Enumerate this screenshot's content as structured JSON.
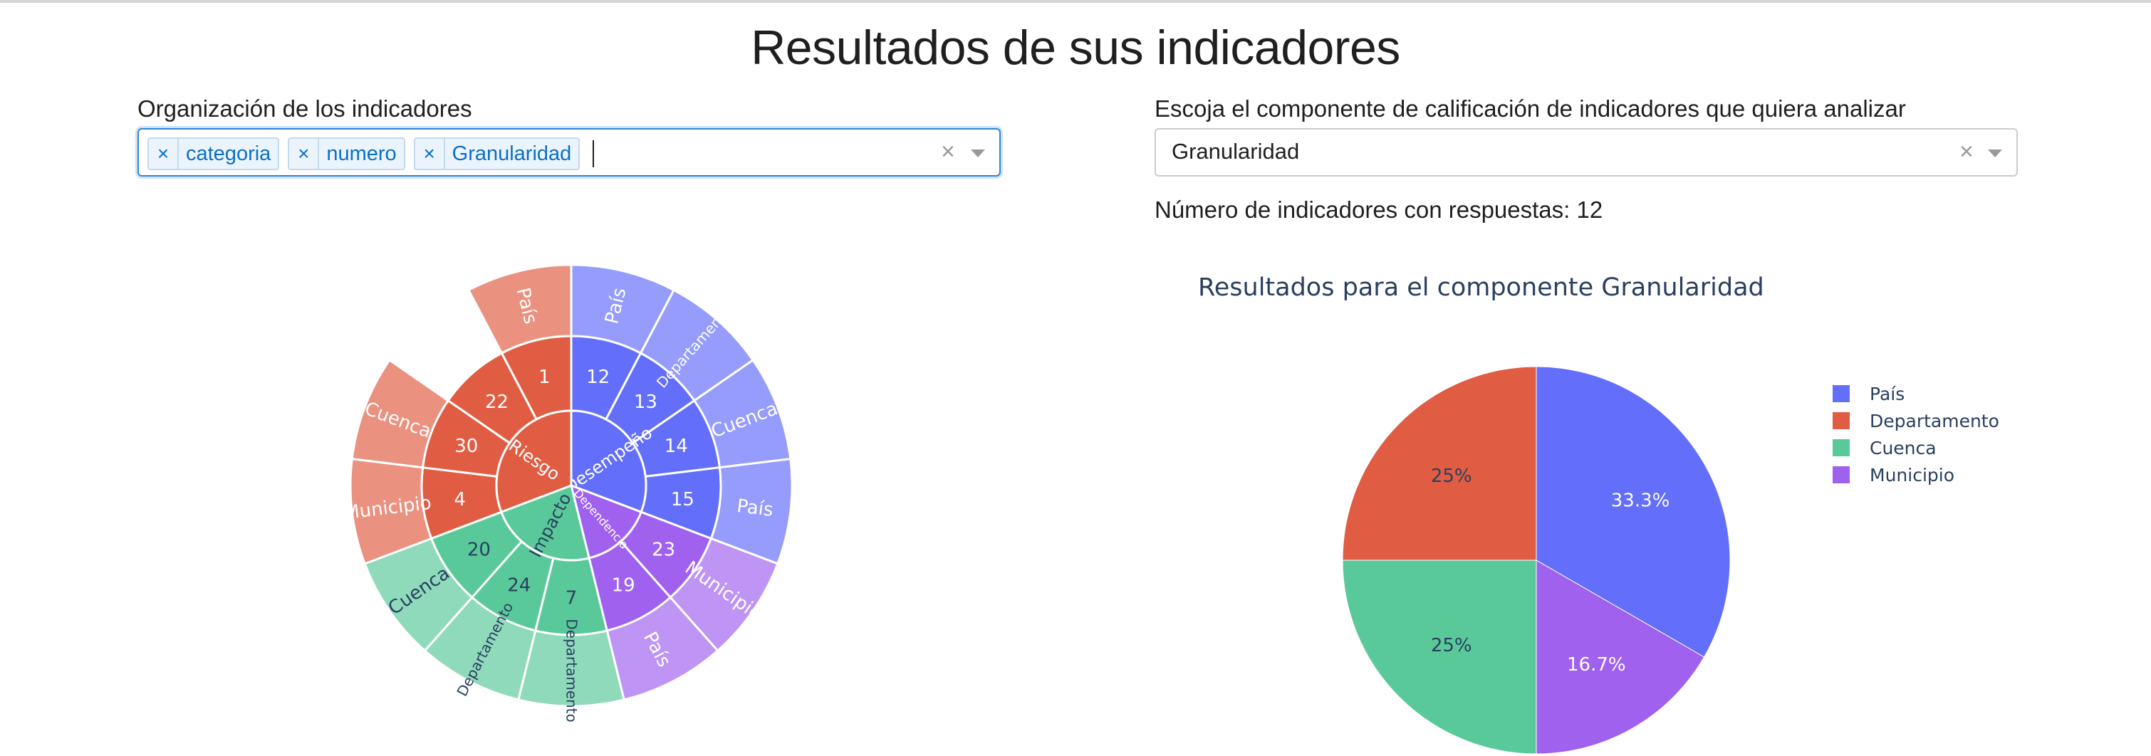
{
  "page": {
    "title": "Resultados de sus indicadores"
  },
  "left_panel": {
    "label": "Organización de los indicadores",
    "chips": [
      "categoria",
      "numero",
      "Granularidad"
    ],
    "chip_remove_glyph": "×",
    "clear_glyph": "×"
  },
  "right_panel": {
    "label": "Escoja el componente de calificación de indicadores que quiera analizar",
    "selected_value": "Granularidad",
    "clear_glyph": "×",
    "count_text": "Número de indicadores con respuestas: 12"
  },
  "icons": {
    "chip_remove": "close-icon",
    "clear": "clear-icon",
    "dropdown_arrow": "chevron-down-icon"
  },
  "colors": {
    "blue": "#636efa",
    "red": "#e05d43",
    "green": "#5ac99a",
    "purple": "#a061ef",
    "focus_border": "#2e84d6",
    "chip_text": "#0b6fc7"
  },
  "chart_data": [
    {
      "type": "sunburst",
      "root_labels": [
        "Desempeño",
        "Dependencia",
        "Impacto",
        "Riesgo"
      ],
      "level2_labels": [
        "12",
        "13",
        "14",
        "15",
        "23",
        "19",
        "7",
        "24",
        "20",
        "4",
        "30",
        "22",
        "1"
      ],
      "level3_labels": [
        "País",
        "Departamento",
        "Cuenca",
        "País",
        "Municipio",
        "País",
        "Departamento",
        "Departamento",
        "Cuenca",
        "Municipio",
        "Cuenca",
        "País"
      ],
      "hierarchy": [
        {
          "name": "Desempeño",
          "color": "#636efa",
          "children": [
            {
              "name": "12",
              "leaf": "País"
            },
            {
              "name": "13",
              "leaf": "Departamento"
            },
            {
              "name": "14",
              "leaf": "Cuenca"
            },
            {
              "name": "15",
              "leaf": "País"
            }
          ]
        },
        {
          "name": "Dependencia",
          "color": "#a061ef",
          "children": [
            {
              "name": "23",
              "leaf": "Municipio"
            },
            {
              "name": "19",
              "leaf": "País"
            }
          ]
        },
        {
          "name": "Impacto",
          "color": "#5ac99a",
          "children": [
            {
              "name": "7",
              "leaf": "Departamento"
            },
            {
              "name": "24",
              "leaf": "Departamento"
            },
            {
              "name": "20",
              "leaf": "Cuenca"
            }
          ]
        },
        {
          "name": "Riesgo",
          "color": "#e05d43",
          "children": [
            {
              "name": "4",
              "leaf": "Municipio"
            },
            {
              "name": "30",
              "leaf": "Cuenca"
            },
            {
              "name": "22",
              "leaf": null
            },
            {
              "name": "1",
              "leaf": "País"
            }
          ]
        }
      ]
    },
    {
      "type": "pie",
      "title": "Resultados para el componente Granularidad",
      "categories": [
        "País",
        "Departamento",
        "Cuenca",
        "Municipio"
      ],
      "values": [
        4,
        3,
        3,
        2
      ],
      "percent_labels": [
        "33.3%",
        "25%",
        "25%",
        "16.7%"
      ],
      "slice_order_clockwise_from_top": [
        "País",
        "Municipio",
        "Cuenca",
        "Departamento"
      ],
      "colors": [
        "#636efa",
        "#e05d43",
        "#5ac99a",
        "#a061ef"
      ],
      "legend": {
        "entries": [
          "País",
          "Departamento",
          "Cuenca",
          "Municipio"
        ],
        "placement": "right"
      }
    }
  ]
}
